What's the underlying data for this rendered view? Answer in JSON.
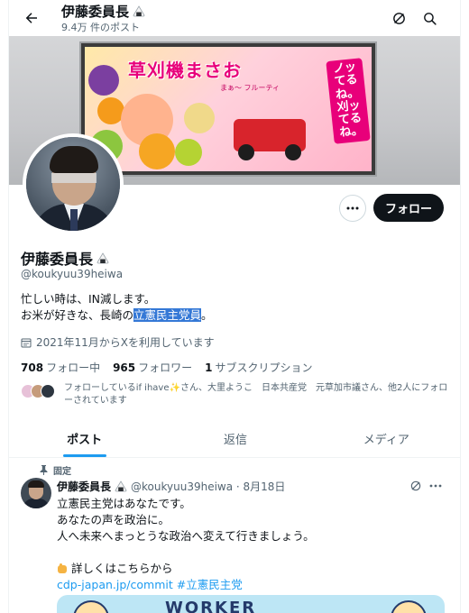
{
  "header": {
    "title": "伊藤委員長",
    "subtitle": "9.4万 件のポスト"
  },
  "banner": {
    "ad_title": "草刈機まさお",
    "ad_vertical": "ノッてるね。刈ッてるね。",
    "ad_sub": "まぁ～ フルーティ"
  },
  "actions": {
    "follow_label": "フォロー"
  },
  "profile": {
    "name": "伊藤委員長",
    "handle": "@koukyuu39heiwa",
    "bio_line1": "忙しい時は、IN減します。",
    "bio_line2_prefix": "お米が好きな、長崎の",
    "bio_line2_highlight": "立憲民主党員",
    "bio_line2_suffix": "。",
    "joined": "2021年11月からXを利用しています",
    "following_count": "708",
    "following_label": "フォロー中",
    "followers_count": "965",
    "followers_label": "フォロワー",
    "subs_count": "1",
    "subs_label": "サブスクリプション",
    "followed_by": "フォローしているif ihave✨さん、大里ようこ　日本共産党　元草加市議さん、他2人にフォローされています"
  },
  "tabs": [
    {
      "label": "ポスト",
      "active": true
    },
    {
      "label": "返信",
      "active": false
    },
    {
      "label": "メディア",
      "active": false
    }
  ],
  "tweet": {
    "pinned_label": "固定",
    "author": "伊藤委員長",
    "handle_date": "@koukyuu39heiwa · 8月18日",
    "line1": "立憲民主党はあなたです。",
    "line2": "あなたの声を政治に。",
    "line3": "人へ未来へまっとうな政治へ変えて行きましょう。",
    "line4": "詳しくはこちらから",
    "link": "cdp-japan.jp/commit #立憲民主党",
    "card_word": "WORKER"
  },
  "colors": {
    "accent": "#1d9bf0",
    "text": "#0f1419",
    "muted": "#536471",
    "highlight": "#3478d6"
  },
  "icons": [
    "back-arrow-icon",
    "grok-icon",
    "search-icon",
    "onigiri-icon",
    "calendar-icon",
    "more-icon",
    "pin-icon"
  ]
}
